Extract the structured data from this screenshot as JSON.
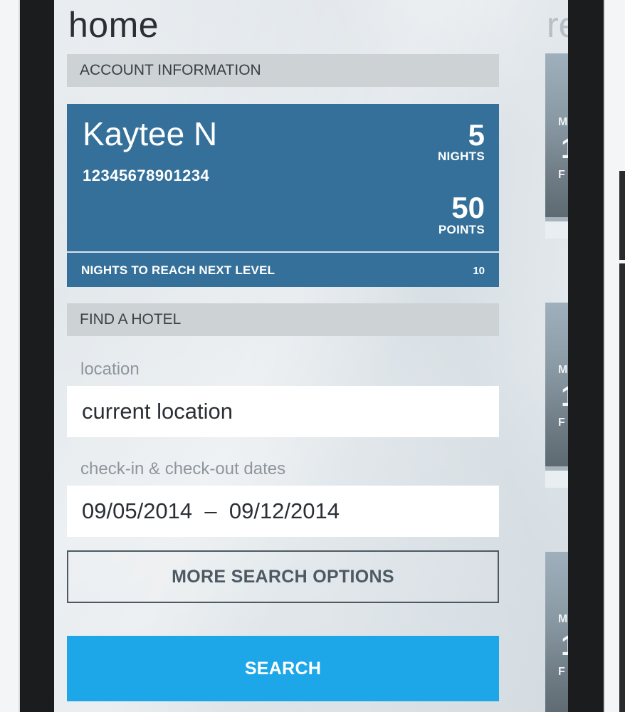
{
  "page": {
    "title": "home",
    "next_page_title_partial": "re"
  },
  "account_section": {
    "header": "ACCOUNT INFORMATION",
    "name": "Kaytee N",
    "member_number": "12345678901234",
    "nights_value": "5",
    "nights_label": "NIGHTS",
    "points_value": "50",
    "points_label": "POINTS",
    "next_level_label": "NIGHTS TO REACH NEXT LEVEL",
    "next_level_value": "10"
  },
  "find_hotel": {
    "header": "FIND A HOTEL",
    "location_label": "location",
    "location_value": "current location",
    "dates_label": "check-in & check-out dates",
    "dates_value": "09/05/2014  –  09/12/2014",
    "more_options_label": "MORE SEARCH OPTIONS",
    "search_label": "SEARCH"
  },
  "preview_cards": [
    {
      "line1": "M",
      "big": "1",
      "line2": "F"
    },
    {
      "line1": "M",
      "big": "1",
      "line2": "F"
    },
    {
      "line1": "M",
      "big": "1",
      "line2": "F"
    }
  ],
  "colors": {
    "account_card_bg": "#34709a",
    "search_button_bg": "#1da6e8",
    "section_header_bg": "#cdd2d5"
  }
}
